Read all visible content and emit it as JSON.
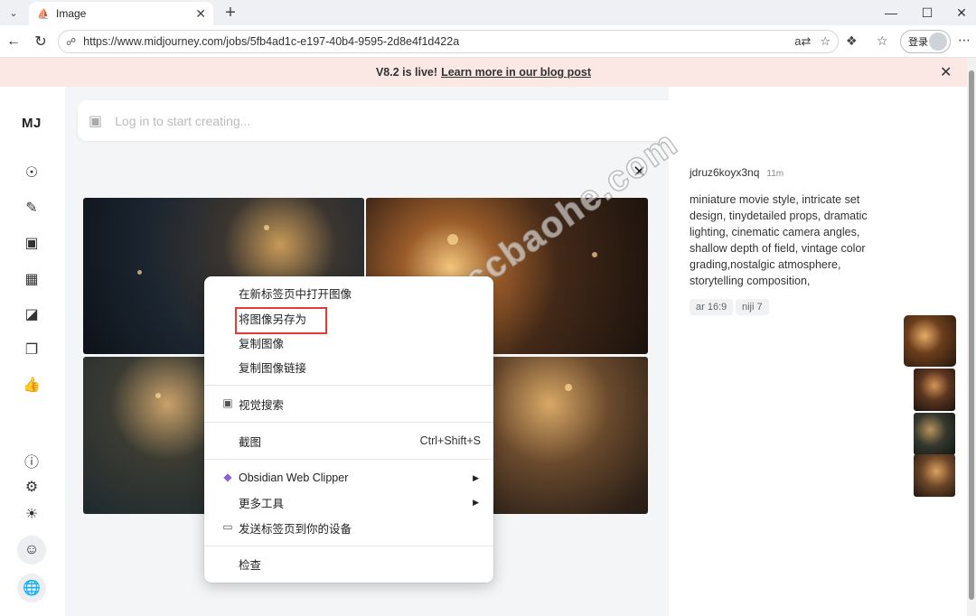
{
  "browser": {
    "tab_title": "Image",
    "tab_favicon": "midjourney-sail-icon",
    "url": "https://www.midjourney.com/jobs/5fb4ad1c-e197-40b4-9595-2d8e4f1d422a",
    "login_label": "登录",
    "new_tab_label": "+"
  },
  "banner": {
    "text": "V8.2 is live!",
    "link": "Learn more in our blog post"
  },
  "app": {
    "logo": "MJ",
    "search_placeholder": "Log in to start creating...",
    "rail_icons": [
      "explore-icon",
      "create-icon",
      "edit-icon",
      "organize-icon",
      "personalize-icon",
      "moodboards-icon",
      "likes-icon"
    ],
    "rail_bottom_icons": [
      "help-icon",
      "bell-icon",
      "theme-icon",
      "account-icon",
      "language-icon"
    ]
  },
  "detail": {
    "username": "jdruz6koyx3nq",
    "time": "11m",
    "prompt": "miniature movie style, intricate set design, tinydetailed props, dramatic lighting, cinematic camera angles, shallow depth of field, vintage color grading,nostalgic atmosphere, storytelling composition,",
    "tags": [
      "ar 16:9",
      "niji 7"
    ]
  },
  "context_menu": {
    "items": [
      {
        "label": "在新标签页中打开图像"
      },
      {
        "label": "将图像另存为"
      },
      {
        "label": "复制图像"
      },
      {
        "label": "复制图像链接"
      },
      {
        "label": "视觉搜索",
        "icon": "visual-search-icon"
      },
      {
        "label": "截图",
        "shortcut": "Ctrl+Shift+S"
      },
      {
        "label": "Obsidian Web Clipper",
        "icon": "obsidian-icon"
      },
      {
        "label": "更多工具"
      },
      {
        "label": "发送标签页到你的设备",
        "icon": "devices-icon"
      },
      {
        "label": "检查"
      }
    ]
  },
  "watermark": "CC宝盒ccbaohe.com",
  "colors": {
    "banner_bg": "#fbe7e4",
    "highlight": "#e53935",
    "main_bg": "#f4f5f7"
  }
}
